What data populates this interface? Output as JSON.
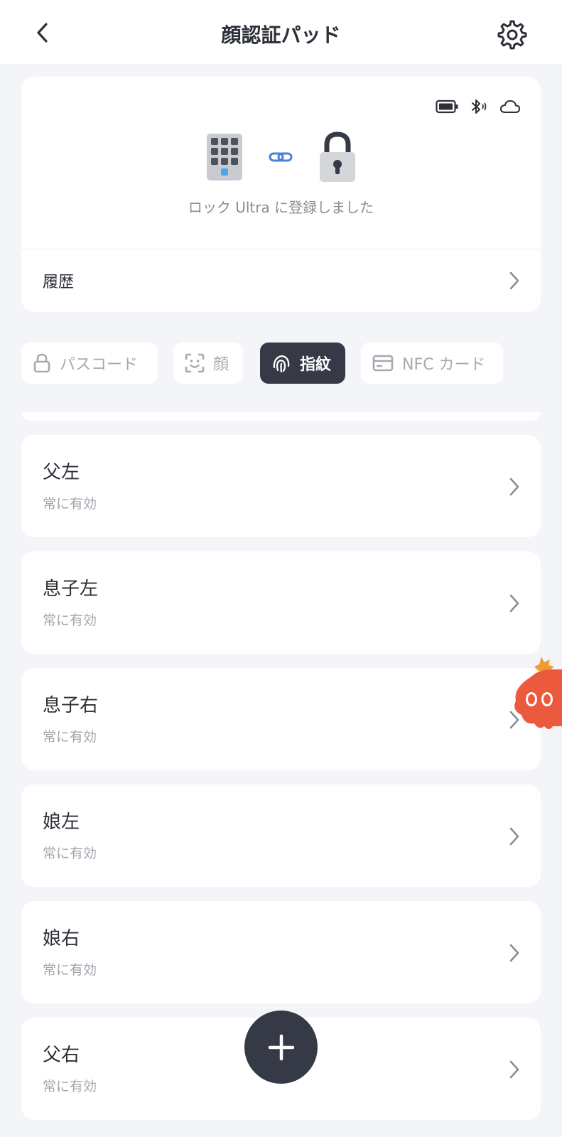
{
  "header": {
    "title": "顔認証パッド",
    "back_icon": "chevron-left-icon",
    "settings_icon": "gear-icon"
  },
  "device": {
    "status_icons": [
      "battery-icon",
      "bluetooth-icon",
      "cloud-icon"
    ],
    "keypad_icon": "keypad-icon",
    "link_icon": "link-icon",
    "lock_icon": "padlock-icon",
    "link_status": "ロック Ultra に登録しました",
    "history_label": "履歴"
  },
  "tabs": [
    {
      "label": "パスコード",
      "icon": "lock-icon",
      "active": false
    },
    {
      "label": "顔",
      "icon": "face-scan-icon",
      "active": false
    },
    {
      "label": "指紋",
      "icon": "fingerprint-icon",
      "active": true
    },
    {
      "label": "NFC カード",
      "icon": "card-icon",
      "active": false
    }
  ],
  "entries": [
    {
      "name": "父左",
      "validity": "常に有効"
    },
    {
      "name": "息子左",
      "validity": "常に有効"
    },
    {
      "name": "息子右",
      "validity": "常に有効"
    },
    {
      "name": "娘左",
      "validity": "常に有効"
    },
    {
      "name": "娘右",
      "validity": "常に有効"
    },
    {
      "name": "父右",
      "validity": "常に有効"
    }
  ],
  "fab_icon": "plus-icon",
  "colors": {
    "background": "#f4f5f8",
    "card": "#ffffff",
    "dark": "#353a46",
    "link_blue": "#4a7fd6",
    "text_secondary": "#a2a5ac"
  }
}
